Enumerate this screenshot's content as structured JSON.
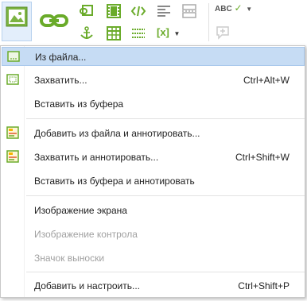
{
  "colors": {
    "accent": "#6aab2a",
    "highlight": "#c6dcf4",
    "disabled_text": "#a0a0a0"
  },
  "ribbon": {
    "buttons": [
      {
        "icon": "image-icon"
      },
      {
        "icon": "link-icon"
      },
      {
        "icon": "embed-link-icon"
      },
      {
        "icon": "video-icon"
      },
      {
        "icon": "code-icon"
      },
      {
        "icon": "align-left-icon"
      },
      {
        "icon": "page-break-icon"
      },
      {
        "icon": "spellcheck-icon"
      },
      {
        "icon": "anchor-icon"
      },
      {
        "icon": "table-icon"
      },
      {
        "icon": "dotted-list-icon"
      },
      {
        "icon": "variable-icon"
      },
      {
        "icon": "comment-icon"
      }
    ],
    "variable_label": "[x]",
    "spell_label": "ABC"
  },
  "menu": {
    "items": [
      {
        "label": "Из файла...",
        "shortcut": "",
        "icon": "image-file-icon",
        "highlighted": true,
        "disabled": false
      },
      {
        "label": "Захватить...",
        "shortcut": "Ctrl+Alt+W",
        "icon": "capture-icon",
        "highlighted": false,
        "disabled": false
      },
      {
        "label": "Вставить из буфера",
        "shortcut": "",
        "icon": "",
        "highlighted": false,
        "disabled": false
      },
      {
        "label": "Добавить из файла и аннотировать...",
        "shortcut": "",
        "icon": "annotate-file-icon",
        "highlighted": false,
        "disabled": false
      },
      {
        "label": "Захватить и аннотировать...",
        "shortcut": "Ctrl+Shift+W",
        "icon": "annotate-capture-icon",
        "highlighted": false,
        "disabled": false
      },
      {
        "label": "Вставить из буфера и аннотировать",
        "shortcut": "",
        "icon": "",
        "highlighted": false,
        "disabled": false
      },
      {
        "label": "Изображение экрана",
        "shortcut": "",
        "icon": "",
        "highlighted": false,
        "disabled": false
      },
      {
        "label": "Изображение контрола",
        "shortcut": "",
        "icon": "",
        "highlighted": false,
        "disabled": true
      },
      {
        "label": "Значок выноски",
        "shortcut": "",
        "icon": "",
        "highlighted": false,
        "disabled": true
      },
      {
        "label": "Добавить и настроить...",
        "shortcut": "Ctrl+Shift+P",
        "icon": "",
        "highlighted": false,
        "disabled": false
      }
    ]
  }
}
